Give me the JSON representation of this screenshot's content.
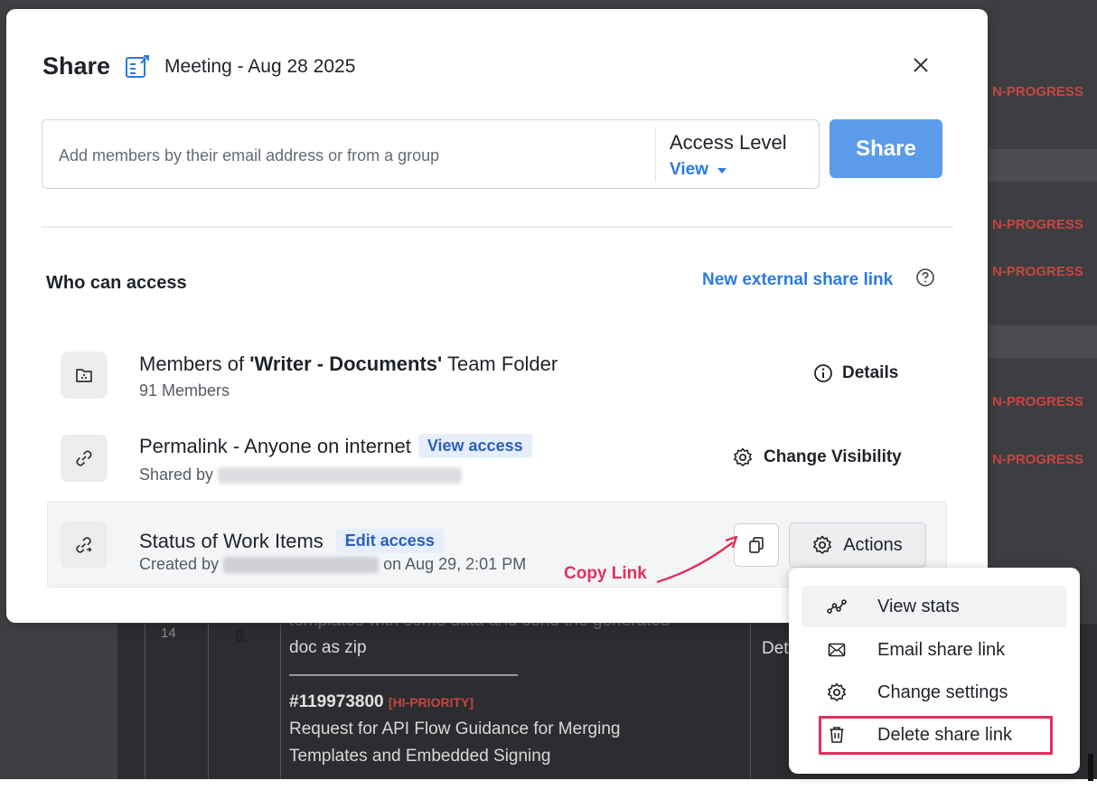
{
  "background": {
    "status_labels": [
      "N-PROGRESS",
      "N-PROGRESS",
      "N-PROGRESS",
      "N-PROGRESS",
      "N-PROGRESS"
    ],
    "row_number": "14",
    "row_index": "8.",
    "cell_line1": "templates with some data and send the generated",
    "cell_line2": "doc as zip",
    "cell_separator": "——————————————",
    "ticket_id": "#119973800",
    "ticket_priority": "[HI-PRIORITY]",
    "ticket_line1": "Request for API Flow Guidance for Merging",
    "ticket_line2": "Templates and Embedded Signing",
    "details_fragment": "Det",
    "status_color": "#c9453f"
  },
  "modal": {
    "title": "Share",
    "document_name": "Meeting - Aug 28 2025",
    "close_icon": "close-icon",
    "add_members": {
      "placeholder": "Add members by their email address or from a group",
      "value": ""
    },
    "access_level": {
      "label": "Access Level",
      "value": "View"
    },
    "share_button": "Share",
    "who_can_access": "Who can access",
    "new_external_link": "New external share link",
    "rows": [
      {
        "icon": "folder-icon",
        "title_prefix": "Members of ",
        "title_bold": "'Writer - Documents'",
        "title_suffix": " Team Folder",
        "subtitle": "91 Members",
        "action": "Details"
      },
      {
        "icon": "link-icon",
        "title": "Permalink - Anyone on internet",
        "badge": "View access",
        "subtitle": "Shared by",
        "action": "Change Visibility"
      },
      {
        "icon": "external-link-icon",
        "title": "Status of Work Items",
        "badge": "Edit access",
        "subtitle_prefix": "Created by",
        "subtitle_suffix": "on Aug 29, 2:01 PM",
        "action": "Actions"
      }
    ],
    "accent_color": "#2a7ae2",
    "share_button_color": "#5b9bea"
  },
  "annotation": {
    "text": "Copy Link",
    "color": "#e1305d"
  },
  "menu": {
    "items": [
      {
        "label": "View stats",
        "icon": "stats-icon"
      },
      {
        "label": "Email share link",
        "icon": "email-icon"
      },
      {
        "label": "Change settings",
        "icon": "gear-icon"
      },
      {
        "label": "Delete share link",
        "icon": "trash-icon"
      }
    ]
  }
}
